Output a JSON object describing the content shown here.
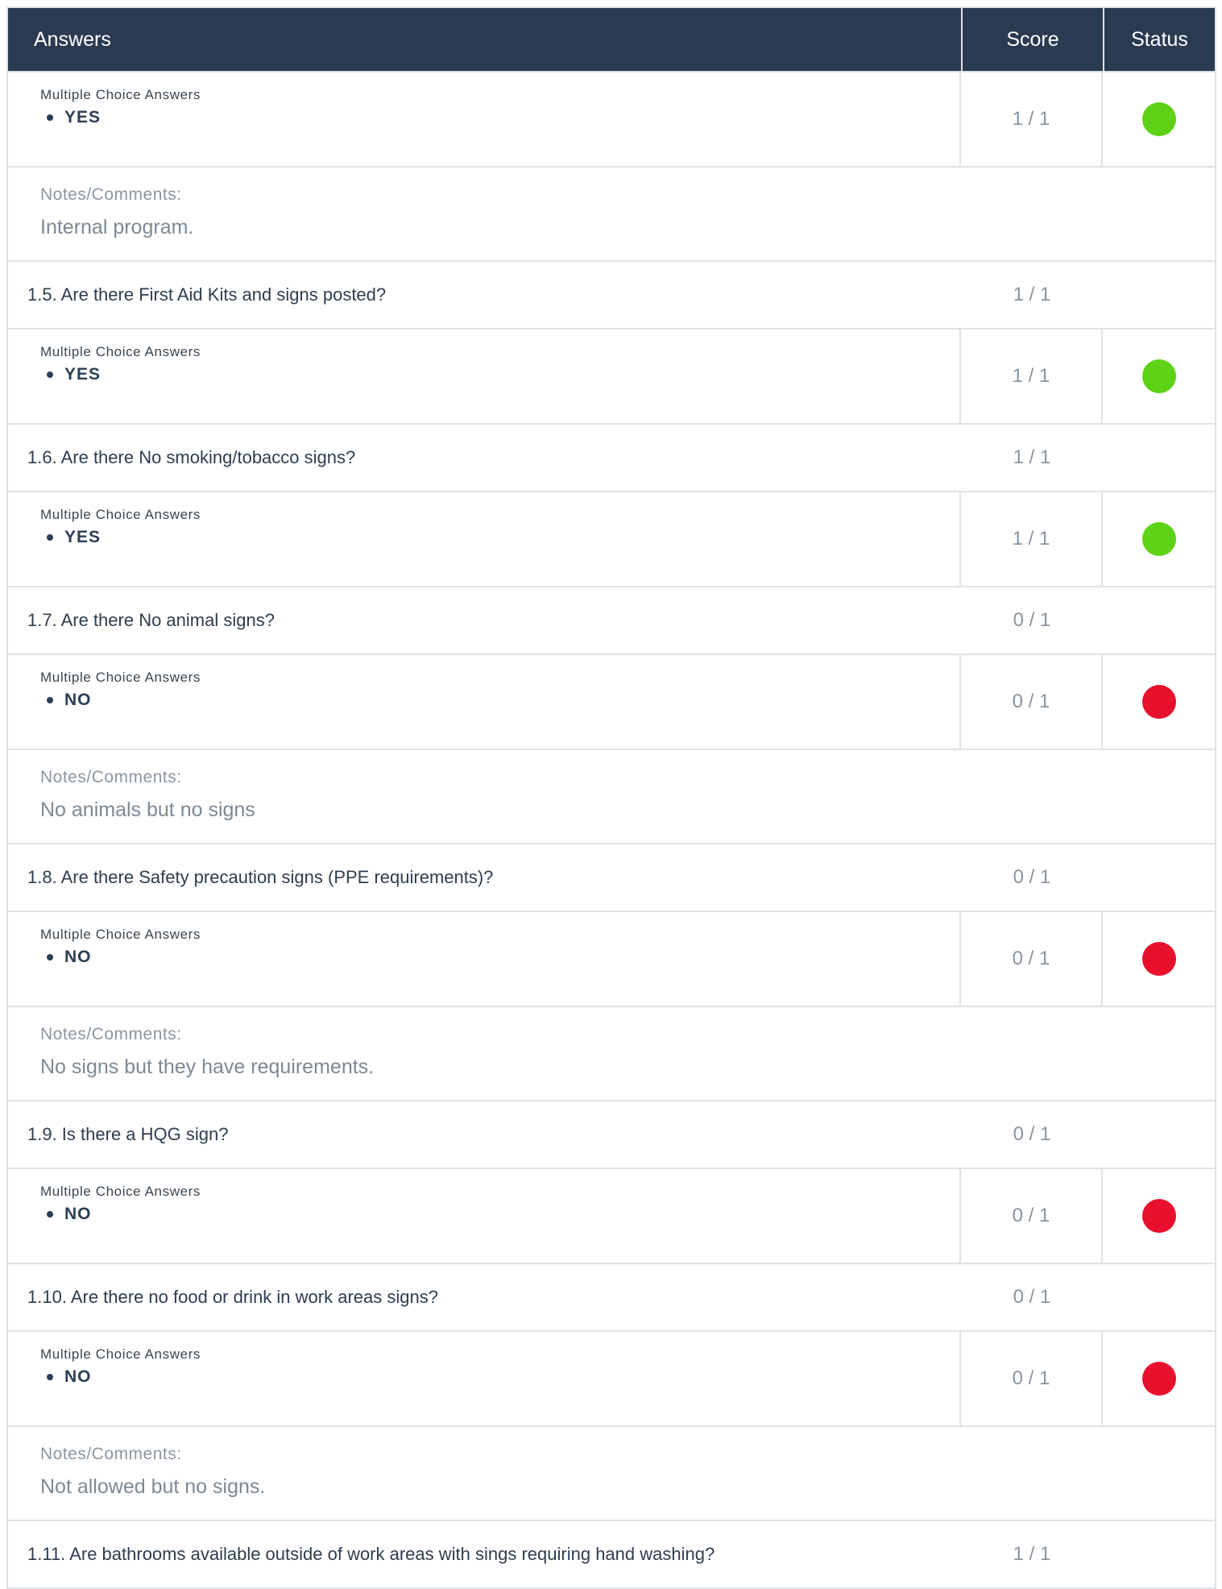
{
  "header": {
    "answers": "Answers",
    "score": "Score",
    "status": "Status"
  },
  "mc_label": "Multiple Choice Answers",
  "notes_label": "Notes/Comments:",
  "colors": {
    "pass": "#5ed217",
    "fail": "#e8102c",
    "header_bg": "#293a51"
  },
  "rows": [
    {
      "kind": "answer",
      "value": "YES",
      "score": "1 / 1",
      "status": "pass"
    },
    {
      "kind": "note",
      "text": "Internal program."
    },
    {
      "kind": "question",
      "text": "1.5. Are there First Aid Kits and signs posted?",
      "score": "1 / 1"
    },
    {
      "kind": "answer",
      "value": "YES",
      "score": "1 / 1",
      "status": "pass"
    },
    {
      "kind": "question",
      "text": "1.6. Are there No smoking/tobacco signs?",
      "score": "1 / 1"
    },
    {
      "kind": "answer",
      "value": "YES",
      "score": "1 / 1",
      "status": "pass"
    },
    {
      "kind": "question",
      "text": "1.7. Are there No animal signs?",
      "score": "0 / 1"
    },
    {
      "kind": "answer",
      "value": "NO",
      "score": "0 / 1",
      "status": "fail"
    },
    {
      "kind": "note",
      "text": "No animals but no signs"
    },
    {
      "kind": "question",
      "text": "1.8. Are there Safety precaution signs (PPE requirements)?",
      "score": "0 / 1"
    },
    {
      "kind": "answer",
      "value": "NO",
      "score": "0 / 1",
      "status": "fail"
    },
    {
      "kind": "note",
      "text": "No signs but they have requirements."
    },
    {
      "kind": "question",
      "text": "1.9. Is there a HQG sign?",
      "score": "0 / 1"
    },
    {
      "kind": "answer",
      "value": "NO",
      "score": "0 / 1",
      "status": "fail"
    },
    {
      "kind": "question",
      "text": "1.10. Are there no food or drink in work areas signs?",
      "score": "0 / 1"
    },
    {
      "kind": "answer",
      "value": "NO",
      "score": "0 / 1",
      "status": "fail"
    },
    {
      "kind": "note",
      "text": "Not allowed but no signs."
    },
    {
      "kind": "question",
      "text": "1.11. Are bathrooms available outside of work areas with sings requiring hand washing?",
      "score": "1 / 1"
    }
  ]
}
